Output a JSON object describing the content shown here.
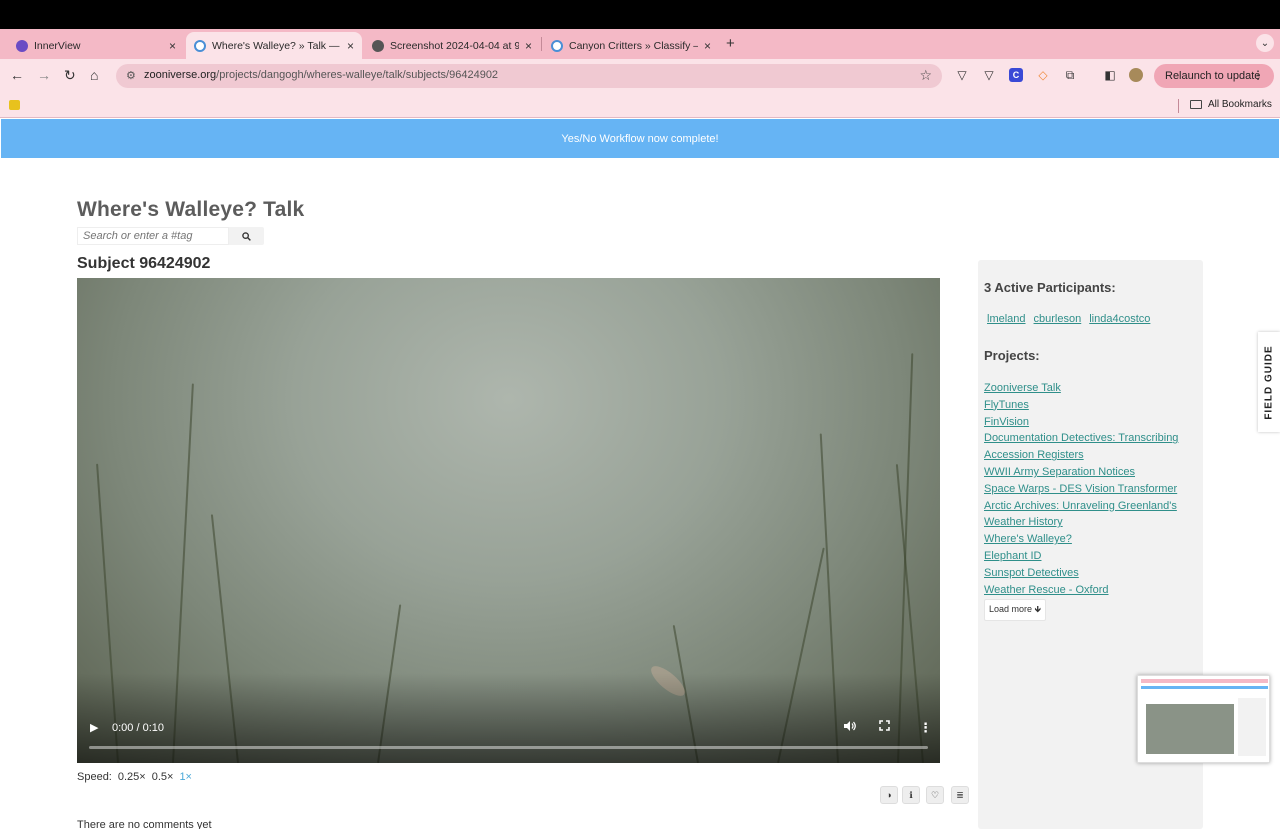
{
  "browser": {
    "tabs": [
      {
        "title": "InnerView",
        "close": "×",
        "color": "#6a4bc4"
      },
      {
        "title": "Where's Walleye? » Talk — Zo",
        "close": "×",
        "color": "#4a8fd6"
      },
      {
        "title": "Screenshot 2024-04-04 at 9",
        "close": "×",
        "color": "#555555"
      },
      {
        "title": "Canyon Critters » Classify —",
        "close": "×",
        "color": "#4a8fd6"
      }
    ],
    "new_tab": "+",
    "tab_list": "⌄",
    "nav": {
      "back": "←",
      "forward": "→",
      "reload": "↻",
      "home": "⌂"
    },
    "url_host": "zooniverse.org",
    "url_path": "/projects/dangogh/wheres-walleye/talk/subjects/96424902",
    "bookmark_star": "☆",
    "relaunch_label": "Relaunch to update",
    "menu_dots": "⋮",
    "bookmarks_all": "All Bookmarks"
  },
  "banner": {
    "text": "Yes/No Workflow now complete!"
  },
  "talk": {
    "title": "Where's Walleye? Talk",
    "search_placeholder": "Search or enter a #tag",
    "search_icon": "search-icon",
    "subject_title": "Subject 96424902"
  },
  "video": {
    "play_icon": "▶",
    "time": "0:00 / 0:10",
    "volume_icon": "🔊",
    "fullscreen_icon": "⛶",
    "more_icon": "⋮",
    "progress": 0
  },
  "speed": {
    "label": "Speed:",
    "options": [
      "0.25×",
      "0.5×",
      "1×"
    ],
    "active": "1×",
    "active_color": "#49a8d8"
  },
  "subject_tools": [
    "◑",
    "ℹ",
    "♡",
    "≣"
  ],
  "comments": {
    "empty_text": "There are no comments yet"
  },
  "sidebar": {
    "participants_heading": "3 Active Participants:",
    "participants": [
      "lmeland",
      "cburleson",
      "linda4costco"
    ],
    "projects_heading": "Projects:",
    "projects": [
      "Zooniverse Talk",
      "FlyTunes",
      "FinVision",
      "Documentation Detectives: Transcribing",
      "Accession Registers",
      "WWII Army Separation Notices",
      "Space Warps - DES Vision Transformer",
      "Arctic Archives: Unraveling Greenland's",
      "Weather History",
      "Where's Walleye?",
      "Elephant ID",
      "Sunspot Detectives",
      "Weather Rescue - Oxford"
    ],
    "load_more": "Load more 🡻",
    "link_color": "#2f8f8a"
  },
  "field_guide": {
    "label": "FIELD GUIDE"
  }
}
